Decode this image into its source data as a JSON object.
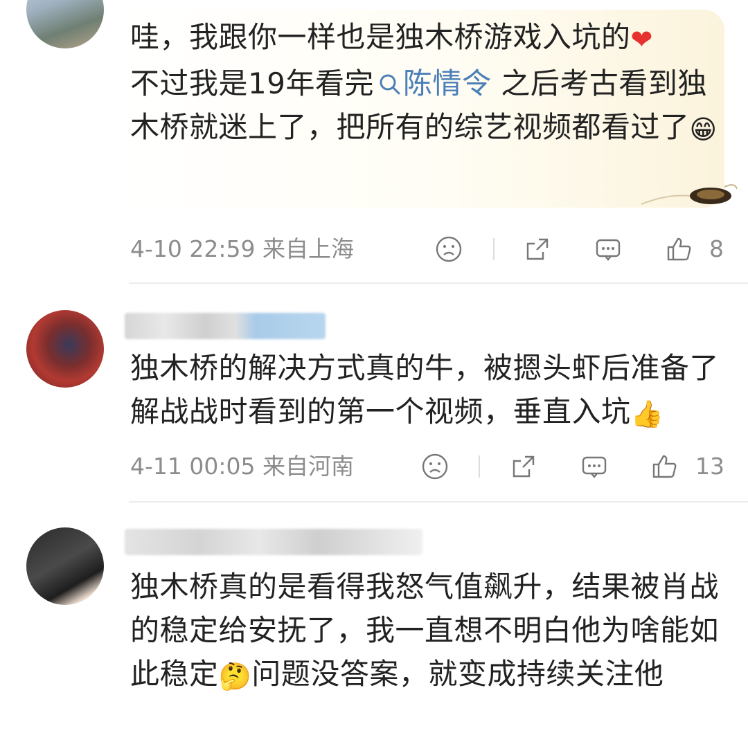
{
  "comments": [
    {
      "text_before_link": "哇，我跟你一样也是独木桥游戏入坑的",
      "heart_emoji": "❤",
      "line2_prefix": "不过我是19年看完",
      "link_text": "陈情令",
      "after_link": "之后考古看到独木桥就迷上了，把所有的综艺视频都看过了",
      "end_emoji": "😁",
      "time": "4-10 22:59 来自上海",
      "likes": "8"
    },
    {
      "text": "独木桥的解决方式真的牛，被摁头虾后准备了解战战时看到的第一个视频，垂直入坑",
      "end_emoji": "👍",
      "time": "4-11 00:05 来自河南",
      "likes": "13"
    },
    {
      "text_part1": "独木桥真的是看得我怒气值飙升，结果被肖战的稳定给安抚了，我一直想不明白他为啥能如此稳定",
      "mid_emoji": "🤔",
      "text_part2": "问题没答案，就变成持续关注他"
    }
  ],
  "colors": {
    "link": "#4a7fb8",
    "meta": "#8c8c8c",
    "heart": "#e6312e"
  },
  "icons": [
    "dislike-icon",
    "share-icon",
    "comment-icon",
    "like-icon",
    "search-icon"
  ]
}
